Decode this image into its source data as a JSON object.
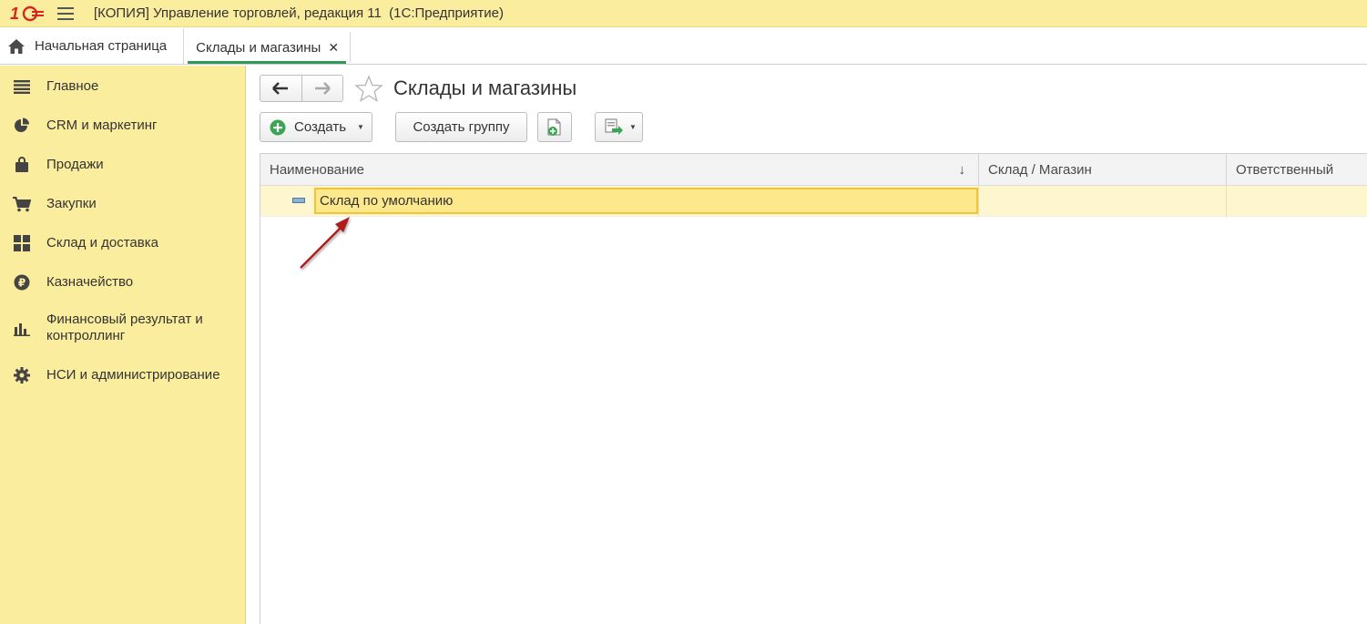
{
  "titlebar": {
    "logo_text": "1С",
    "title": "[КОПИЯ] Управление торговлей, редакция 11  (1С:Предприятие)",
    "brand_color": "#d7261e"
  },
  "tabs": {
    "home_label": "Начальная страница",
    "active_label": "Склады и магазины",
    "close_glyph": "✕"
  },
  "sidebar": {
    "items": [
      {
        "label": "Главное",
        "icon": "menu-lines-icon"
      },
      {
        "label": "CRM и маркетинг",
        "icon": "pie-chart-icon"
      },
      {
        "label": "Продажи",
        "icon": "shopping-bag-icon"
      },
      {
        "label": "Закупки",
        "icon": "cart-icon"
      },
      {
        "label": "Склад и доставка",
        "icon": "warehouse-grid-icon"
      },
      {
        "label": "Казначейство",
        "icon": "ruble-coin-icon"
      },
      {
        "label": "Финансовый результат и",
        "label2": "контроллинг",
        "icon": "bar-chart-icon"
      },
      {
        "label": "НСИ и администрирование",
        "icon": "gear-icon"
      }
    ]
  },
  "page": {
    "title": "Склады и магазины"
  },
  "toolbar": {
    "create_label": "Создать",
    "create_group_label": "Создать группу"
  },
  "table": {
    "columns": [
      "Наименование",
      "Склад / Магазин",
      "Ответственный"
    ],
    "sort_glyph": "↓",
    "rows": [
      {
        "name": "Склад по умолчанию",
        "store": "",
        "responsible": ""
      }
    ]
  },
  "colors": {
    "sidebar_bg": "#fbed9e",
    "selection_border": "#f1c438",
    "active_tab_underline": "#2e9a55",
    "annotation_arrow": "#b01e1e"
  }
}
